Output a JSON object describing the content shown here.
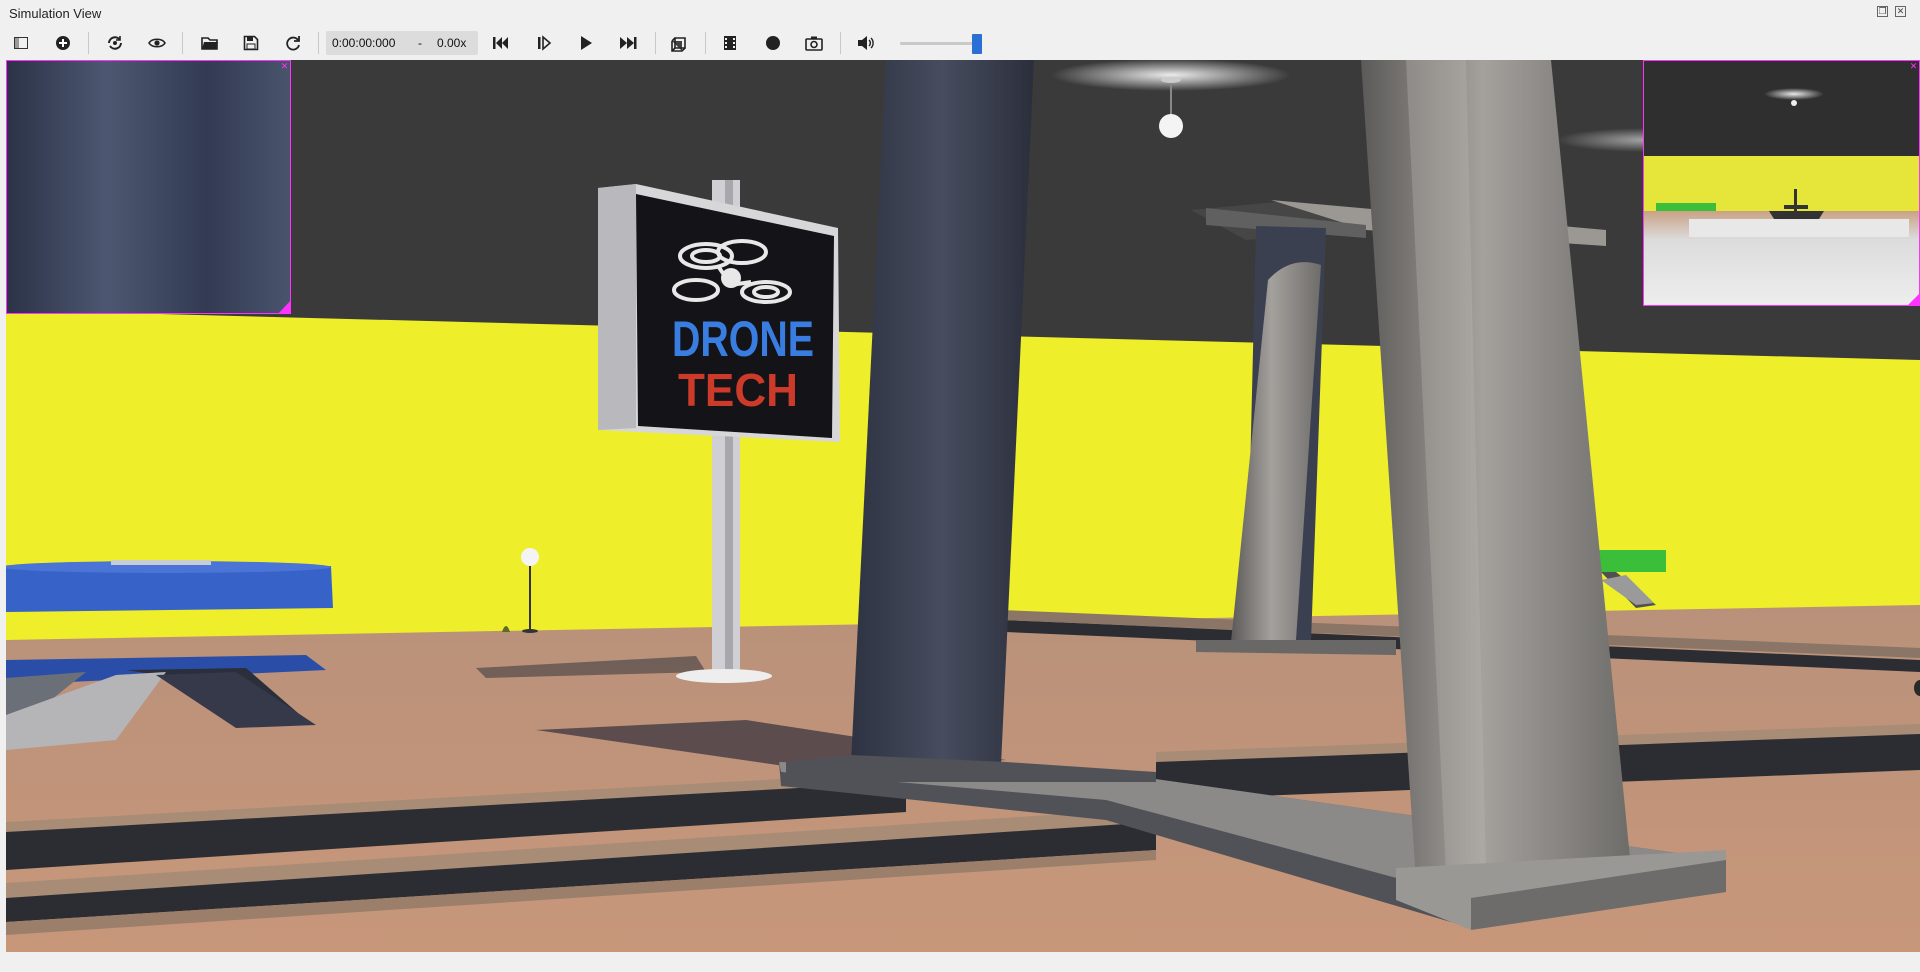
{
  "window": {
    "title": "Simulation View"
  },
  "toolbar": {
    "time_display": "0:00:00:000",
    "time_separator": "-",
    "speed_display": "0.00x",
    "volume_level_percent": 85,
    "icons": [
      "sidebar-toggle-icon",
      "add-object-icon",
      "view-follow-icon",
      "eye-icon",
      "open-folder-icon",
      "save-icon",
      "reload-icon",
      "step-back-icon",
      "step-forward-icon",
      "play-icon",
      "fast-forward-icon",
      "3d-box-icon",
      "movie-icon",
      "record-icon",
      "camera-icon",
      "speaker-icon"
    ]
  },
  "scene": {
    "sign_line1": "DRONE",
    "sign_line2": "TECH",
    "colors": {
      "wall_yellow": "#eeee2a",
      "ceiling": "#3a3a3a",
      "floor": "#c49577",
      "pillar_dark": "#3c4254",
      "pillar_stone": "#8f8d8b",
      "sign_blue": "#3a7de0",
      "sign_red": "#cc3a2a",
      "table_blue": "#3763c8",
      "inset_border": "#ff33ff",
      "accent_blue": "#2a6fd6"
    }
  }
}
